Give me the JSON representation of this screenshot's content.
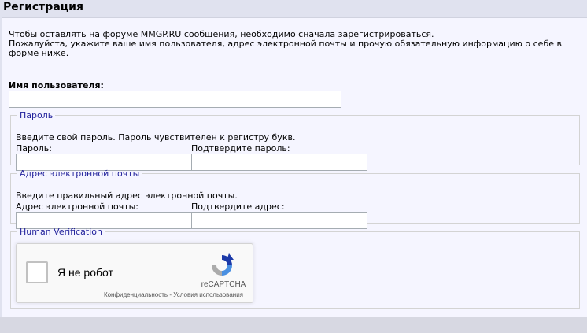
{
  "header": {
    "title": "Регистрация"
  },
  "intro": {
    "line1": "Чтобы оставлять на форуме MMGP.RU сообщения, необходимо сначала зарегистрироваться.",
    "line2": "Пожалуйста, укажите ваше имя пользователя, адрес электронной почты и прочую обязательную информацию о себе в форме ниже."
  },
  "username": {
    "label": "Имя пользователя:",
    "value": ""
  },
  "password_group": {
    "legend": "Пароль",
    "hint": "Введите свой пароль. Пароль чувствителен к регистру букв.",
    "password_label": "Пароль:",
    "confirm_label": "Подтвердите пароль:"
  },
  "email_group": {
    "legend": "Адрес электронной почты",
    "hint": "Введите правильный адрес электронной почты.",
    "email_label": "Адрес электронной почты:",
    "confirm_label": "Подтвердите адрес:"
  },
  "verification_group": {
    "legend": "Human Verification",
    "recaptcha": {
      "label": "Я не робот",
      "brand": "reCAPTCHA",
      "privacy": "Конфиденциальность",
      "separator": " - ",
      "terms": "Условия использования"
    }
  },
  "colors": {
    "header_bg": "#e0e2ef",
    "panel_bg": "#f5f5ff",
    "legend_text": "#22229c",
    "footer_bg": "#d7d8e2"
  }
}
